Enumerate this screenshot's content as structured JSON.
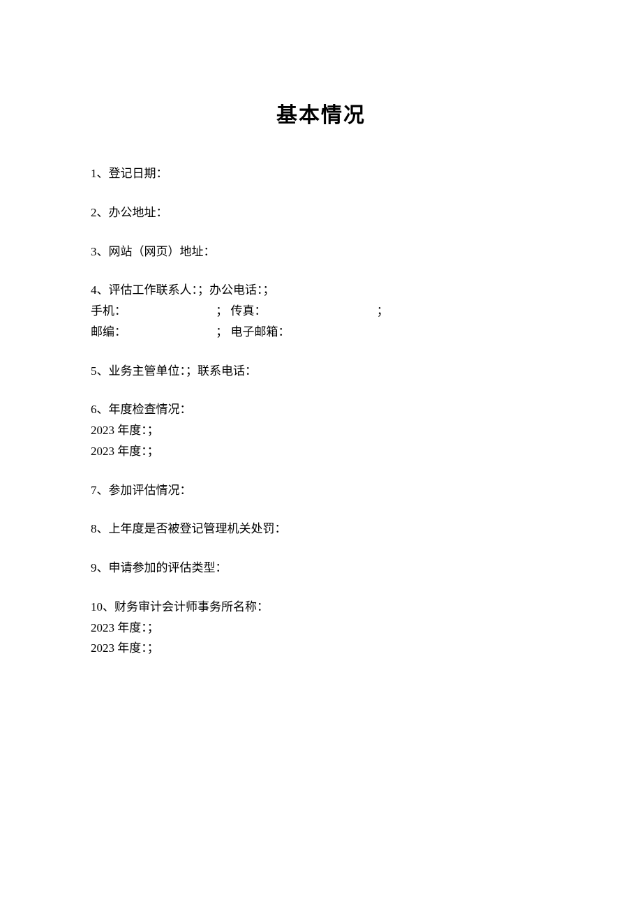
{
  "title": "基本情况",
  "items": {
    "i1": {
      "label": "1、登记日期："
    },
    "i2": {
      "label": "2、办公地址："
    },
    "i3": {
      "label": "3、网站（网页）地址："
    },
    "i4": {
      "label": "4、评估工作联系人：；办公电话：；",
      "phone_label": "手机：",
      "separator1": "；",
      "fax_label": "传真：",
      "separator2": "；",
      "postcode_label": "邮编：",
      "separator3": "；",
      "email_label": "电子邮箱："
    },
    "i5": {
      "label": "5、业务主管单位：；联系电话："
    },
    "i6": {
      "label": "6、年度检查情况：",
      "year1": "2023 年度：；",
      "year2": "2023 年度：；"
    },
    "i7": {
      "label": "7、参加评估情况："
    },
    "i8": {
      "label": "8、上年度是否被登记管理机关处罚："
    },
    "i9": {
      "label": "9、申请参加的评估类型："
    },
    "i10": {
      "label": "10、财务审计会计师事务所名称：",
      "year1": "2023 年度：；",
      "year2": "2023 年度：；"
    }
  }
}
